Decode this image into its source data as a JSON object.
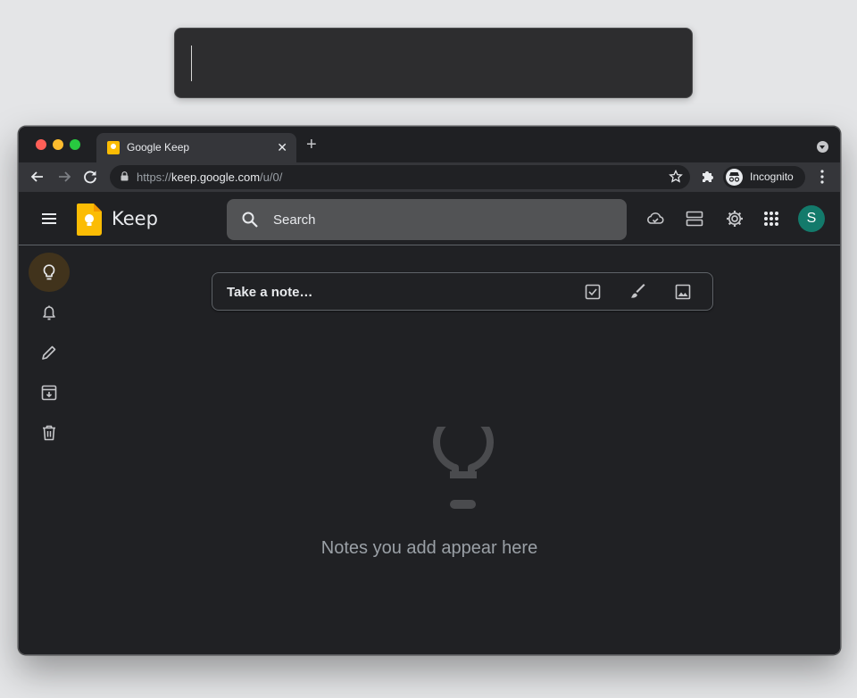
{
  "overlay": {
    "value": ""
  },
  "browser": {
    "tab": {
      "title": "Google Keep",
      "favicon": "keep-favicon"
    },
    "url": {
      "scheme": "https://",
      "host": "keep.google.com",
      "path": "/u/0/"
    },
    "profile_label": "Incognito"
  },
  "keep": {
    "app_name": "Keep",
    "search": {
      "placeholder": "Search"
    },
    "avatar_letter": "S",
    "sidebar": [
      {
        "name": "notes",
        "icon": "lightbulb-icon",
        "active": true
      },
      {
        "name": "reminders",
        "icon": "bell-icon",
        "active": false
      },
      {
        "name": "edit-labels",
        "icon": "pencil-icon",
        "active": false
      },
      {
        "name": "archive",
        "icon": "archive-icon",
        "active": false
      },
      {
        "name": "trash",
        "icon": "trash-icon",
        "active": false
      }
    ],
    "note_input": {
      "placeholder": "Take a note…"
    },
    "empty_state": {
      "message": "Notes you add appear here"
    },
    "colors": {
      "accent": "#fbbc04",
      "background": "#202124",
      "avatar": "#137a6b",
      "active_item": "#41331c"
    }
  }
}
